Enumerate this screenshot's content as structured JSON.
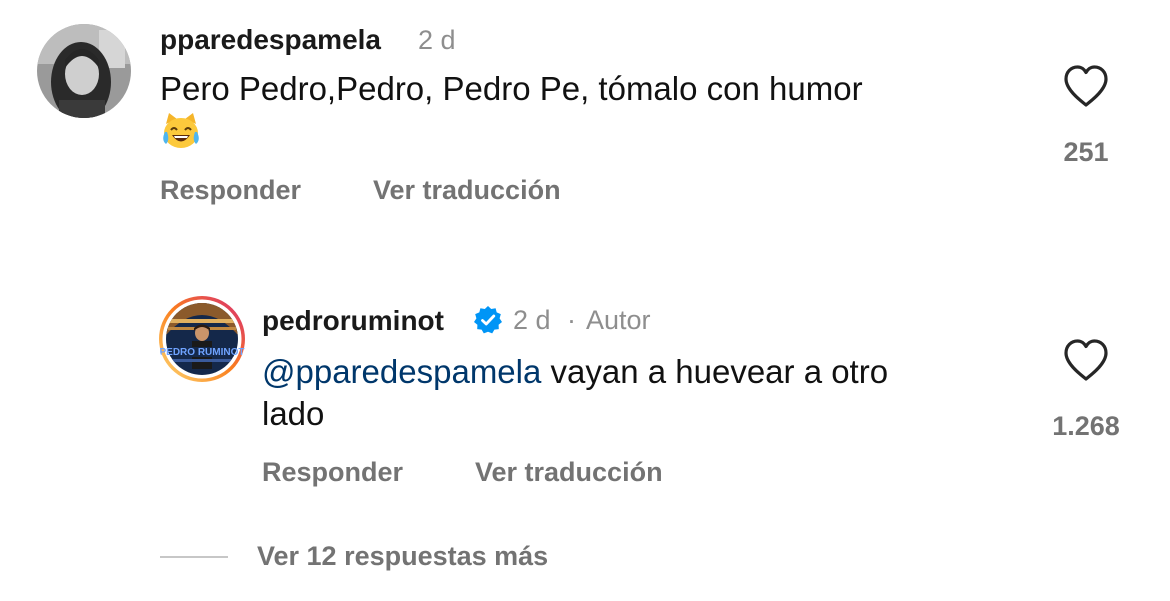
{
  "comment": {
    "username": "pparedespamela",
    "time": "2 d",
    "text": "Pero Pedro,Pedro, Pedro Pe, tómalo con humor",
    "emoji": "joy-cat-emoji",
    "likes": "251",
    "actions": {
      "reply": "Responder",
      "translate": "Ver traducción"
    }
  },
  "reply": {
    "username": "pedroruminot",
    "verified": true,
    "time": "2 d",
    "separator": "·",
    "author_badge": "Autor",
    "mention": "@pparedespamela",
    "text_line1": "vayan a huevear a otro",
    "text_line2": "lado",
    "avatar_caption": "PEDRO RUMINOT",
    "likes": "1.268",
    "actions": {
      "reply": "Responder",
      "translate": "Ver traducción"
    }
  },
  "more_replies": "Ver 12 respuestas más",
  "colors": {
    "mention": "#00376b",
    "secondary_text": "#737373",
    "meta_text": "#8e8e8e",
    "verified": "#0095f6",
    "story_ring_start": "#feda75",
    "story_ring_end": "#d62976"
  }
}
